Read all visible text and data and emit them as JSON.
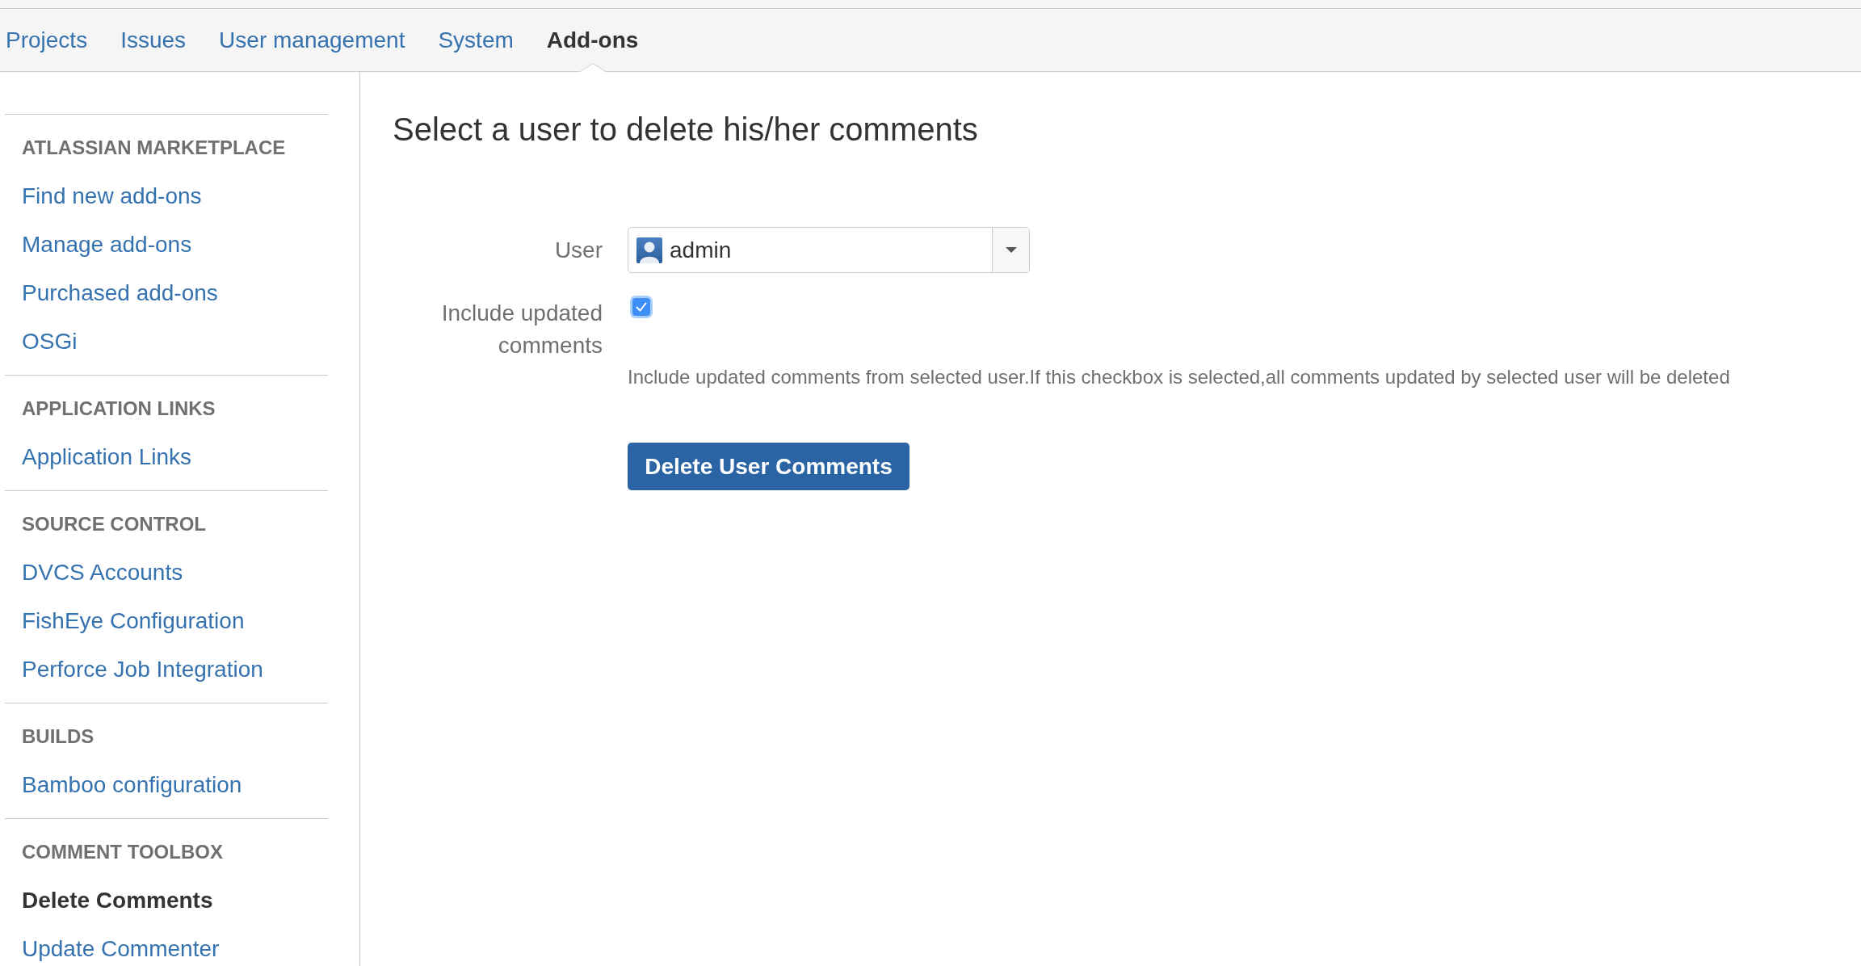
{
  "nav": {
    "tabs": [
      {
        "label": "Projects",
        "selected": false
      },
      {
        "label": "Issues",
        "selected": false
      },
      {
        "label": "User management",
        "selected": false
      },
      {
        "label": "System",
        "selected": false
      },
      {
        "label": "Add-ons",
        "selected": true
      }
    ]
  },
  "sidebar": {
    "sections": [
      {
        "heading": "ATLASSIAN MARKETPLACE",
        "items": [
          {
            "label": "Find new add-ons",
            "selected": false
          },
          {
            "label": "Manage add-ons",
            "selected": false
          },
          {
            "label": "Purchased add-ons",
            "selected": false
          },
          {
            "label": "OSGi",
            "selected": false
          }
        ]
      },
      {
        "heading": "APPLICATION LINKS",
        "items": [
          {
            "label": "Application Links",
            "selected": false
          }
        ]
      },
      {
        "heading": "SOURCE CONTROL",
        "items": [
          {
            "label": "DVCS Accounts",
            "selected": false
          },
          {
            "label": "FishEye Configuration",
            "selected": false
          },
          {
            "label": "Perforce Job Integration",
            "selected": false
          }
        ]
      },
      {
        "heading": "BUILDS",
        "items": [
          {
            "label": "Bamboo configuration",
            "selected": false
          }
        ]
      },
      {
        "heading": "COMMENT TOOLBOX",
        "items": [
          {
            "label": "Delete Comments",
            "selected": true
          },
          {
            "label": "Update Commenter",
            "selected": false
          }
        ]
      }
    ]
  },
  "content": {
    "title": "Select a user to delete his/her comments",
    "form": {
      "user": {
        "label": "User",
        "value": "admin"
      },
      "include_updated": {
        "label": "Include updated comments",
        "checked": true,
        "description": "Include updated comments from selected user.If this checkbox is selected,all comments updated by selected user will be deleted"
      },
      "submit_button": "Delete User Comments"
    }
  }
}
